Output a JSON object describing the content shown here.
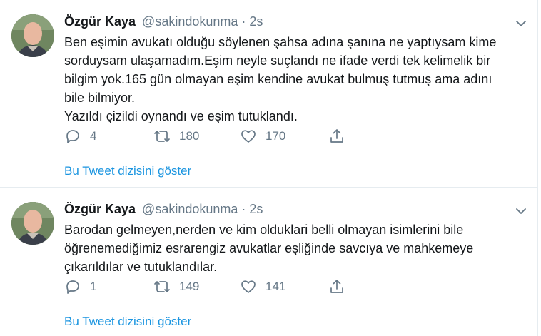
{
  "tweets": [
    {
      "author_name": "Özgür Kaya",
      "handle": "@sakindokunma",
      "separator": "·",
      "time": "2s",
      "lines": [
        "Ben eşimin avukatı olduğu söylenen şahsa adına şanına ne yaptıysam kime",
        "sorduysam ulaşamadım.Eşim neyle suçlandı ne ifade verdi tek kelimelik bir",
        "bilgim yok.165 gün olmayan eşim kendine avukat bulmuş tutmuş ama adını",
        "bile bilmiyor.",
        "Yazıldı çizildi oynandı ve eşim tutuklandı."
      ],
      "reply_count": "4",
      "retweet_count": "180",
      "like_count": "170",
      "thread_link": "Bu Tweet dizisini göster"
    },
    {
      "author_name": "Özgür Kaya",
      "handle": "@sakindokunma",
      "separator": "·",
      "time": "2s",
      "lines": [
        "Barodan gelmeyen,nerden ve kim oldukl​ari belli olmayan isimlerini bile",
        "öğrenemediğimiz esrarengiz avukatlar eşliğinde savcıya ve mahkemeye",
        "çıkarıldılar ve tutuklandılar."
      ],
      "reply_count": "1",
      "retweet_count": "149",
      "like_count": "141",
      "thread_link": "Bu Tweet dizisini göster"
    }
  ],
  "colors": {
    "link": "#1b95e0",
    "secondary_text": "#657786",
    "divider": "#e6ecf0"
  },
  "icons": [
    "reply-icon",
    "retweet-icon",
    "like-icon",
    "share-icon",
    "chevron-down-icon"
  ]
}
